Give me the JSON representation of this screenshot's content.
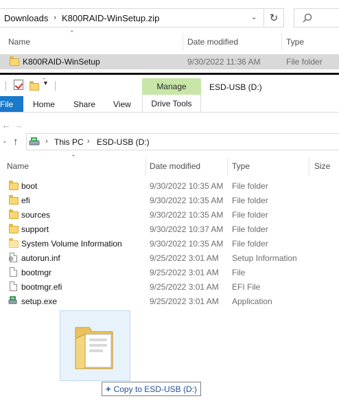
{
  "top_window": {
    "breadcrumb": [
      "Downloads",
      "K800RAID-WinSetup.zip"
    ],
    "columns": {
      "name": "Name",
      "date_modified": "Date modified",
      "type": "Type"
    },
    "rows": [
      {
        "name": "K800RAID-WinSetup",
        "date": "9/30/2022 11:36 AM",
        "type": "File folder",
        "icon": "folder-icon",
        "selected": true
      }
    ]
  },
  "ribbon": {
    "context_tab": "Manage",
    "tabs": [
      "File",
      "Home",
      "Share",
      "View"
    ],
    "context_subtab": "Drive Tools",
    "window_title": "ESD-USB (D:)"
  },
  "address": {
    "path": [
      "This PC",
      "ESD-USB (D:)"
    ]
  },
  "list": {
    "columns": {
      "name": "Name",
      "date_modified": "Date modified",
      "type": "Type",
      "size": "Size"
    },
    "rows": [
      {
        "name": "boot",
        "date": "9/30/2022 10:35 AM",
        "type": "File folder",
        "icon": "folder-icon"
      },
      {
        "name": "efi",
        "date": "9/30/2022 10:35 AM",
        "type": "File folder",
        "icon": "folder-icon"
      },
      {
        "name": "sources",
        "date": "9/30/2022 10:35 AM",
        "type": "File folder",
        "icon": "folder-icon"
      },
      {
        "name": "support",
        "date": "9/30/2022 10:37 AM",
        "type": "File folder",
        "icon": "folder-icon"
      },
      {
        "name": "System Volume Information",
        "date": "9/30/2022 10:35 AM",
        "type": "File folder",
        "icon": "folder-light-icon"
      },
      {
        "name": "autorun.inf",
        "date": "9/25/2022 3:01 AM",
        "type": "Setup Information",
        "icon": "settings-file-icon"
      },
      {
        "name": "bootmgr",
        "date": "9/25/2022 3:01 AM",
        "type": "File",
        "icon": "file-icon"
      },
      {
        "name": "bootmgr.efi",
        "date": "9/25/2022 3:01 AM",
        "type": "EFI File",
        "icon": "file-icon"
      },
      {
        "name": "setup.exe",
        "date": "9/25/2022 3:01 AM",
        "type": "Application",
        "icon": "setup-exe-icon"
      }
    ]
  },
  "drag": {
    "tooltip": "Copy to ESD-USB (D:)",
    "plus": "+"
  },
  "colors": {
    "file_tab": "#1979ca",
    "manage_tab": "#c9e6a8",
    "selection": "#d9d9d9",
    "tooltip_text": "#1f4e99"
  }
}
